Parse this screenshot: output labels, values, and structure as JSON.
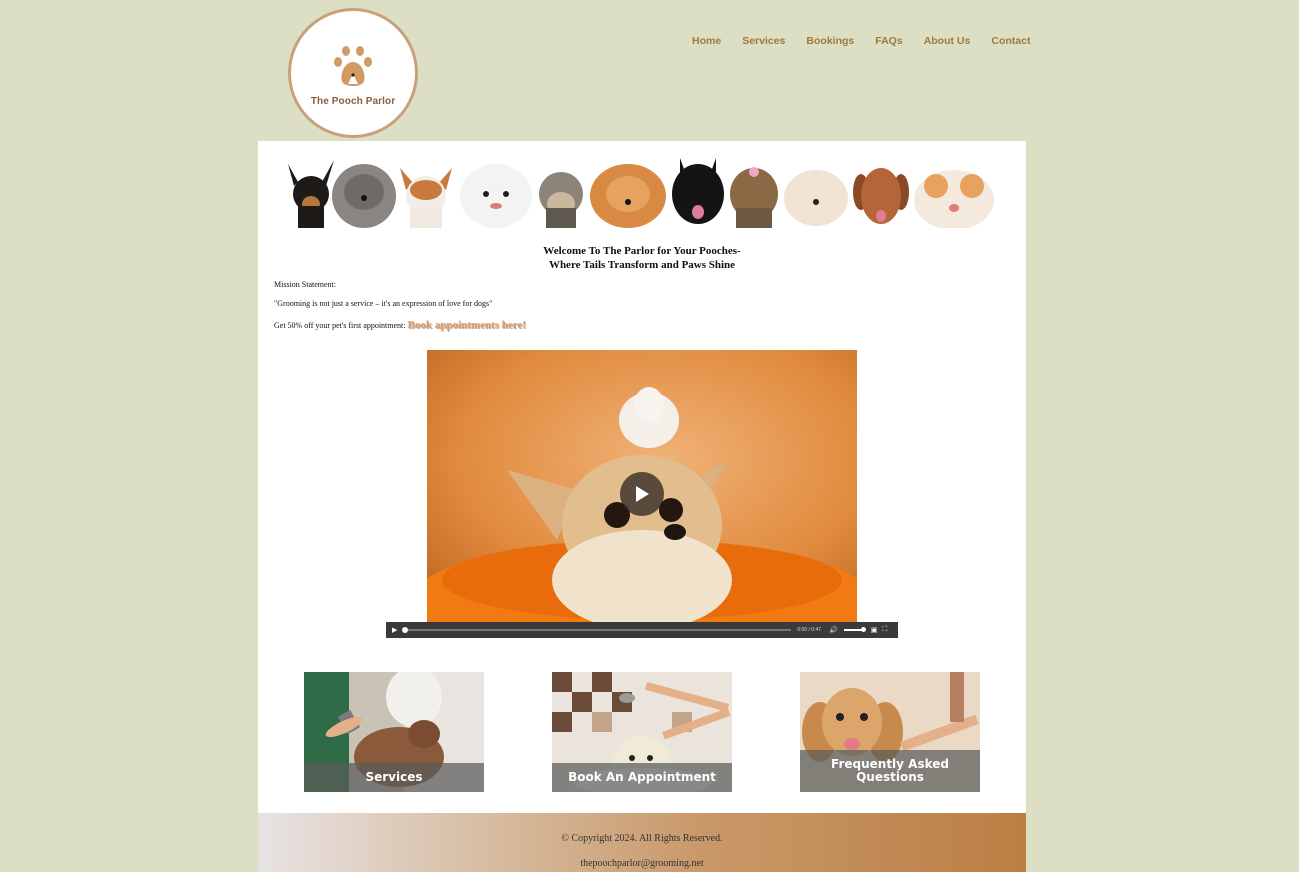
{
  "brand": {
    "name": "The Pooch Parlor",
    "logo_icon": "paw-icon",
    "logo_color": "#d29a63",
    "ring_color": "#c9a07a"
  },
  "nav": {
    "items": [
      {
        "label": "Home"
      },
      {
        "label": "Services"
      },
      {
        "label": "Bookings"
      },
      {
        "label": "FAQs"
      },
      {
        "label": "About Us"
      },
      {
        "label": "Contact"
      }
    ],
    "color": "#a0793a"
  },
  "main": {
    "welcome_line1": "Welcome To The Parlor for Your Pooches-",
    "welcome_line2": "Where Tails Transform and Paws Shine",
    "mission_label": "Mission Statement:",
    "mission_quote": "\"Grooming is not just a service – it's an expression of love for dogs\"",
    "promo_text": "Get 50% off your pet's first appointment: ",
    "promo_link": "Book appointments here!"
  },
  "video": {
    "time": "0:00 / 0:47",
    "progress": 0.0,
    "volume": 1.0
  },
  "cards": [
    {
      "label": "Services"
    },
    {
      "label": "Book An Appointment"
    },
    {
      "label_line1": "Frequently Asked",
      "label_line2": "Questions"
    }
  ],
  "footer": {
    "copyright": "© Copyright 2024. All Rights Reserved.",
    "email": "thepoochparlor@grooming.net"
  },
  "colors": {
    "page_bg": "#dcdfc4",
    "accent": "#d4a17a",
    "footer_start": "#e7e3e3",
    "footer_end": "#bb7f44"
  }
}
